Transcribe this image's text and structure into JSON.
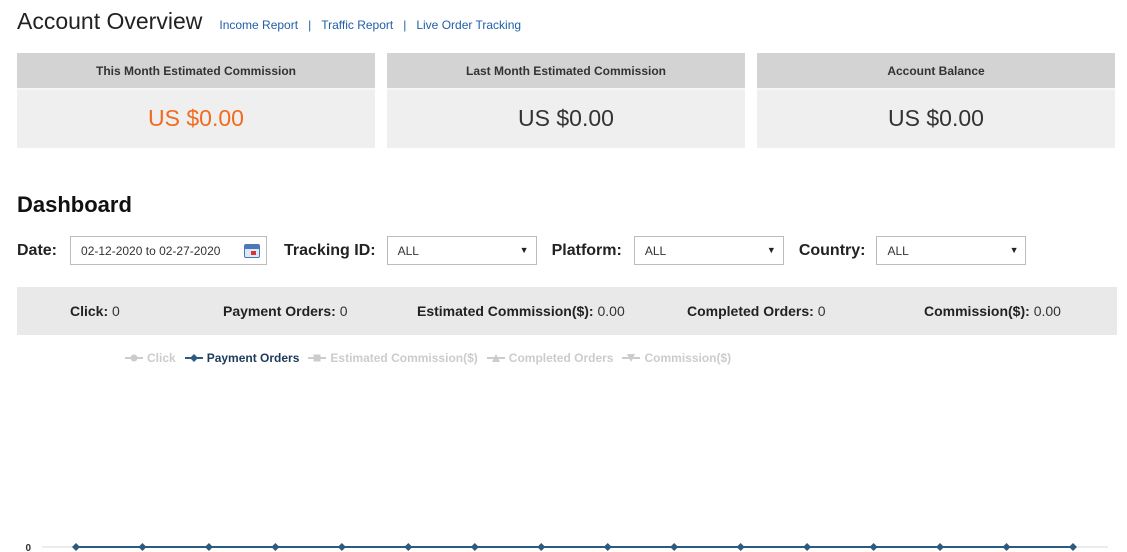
{
  "header": {
    "title": "Account Overview",
    "links": [
      "Income Report",
      "Traffic Report",
      "Live Order Tracking"
    ],
    "separator": "|"
  },
  "cards": [
    {
      "label": "This Month Estimated Commission",
      "value": "US $0.00",
      "color": "#f26b1d"
    },
    {
      "label": "Last Month Estimated Commission",
      "value": "US $0.00",
      "color": "#333333"
    },
    {
      "label": "Account Balance",
      "value": "US $0.00",
      "color": "#333333"
    }
  ],
  "dashboard": {
    "title": "Dashboard",
    "date_label": "Date:",
    "date_value": "02-12-2020 to 02-27-2020",
    "tracking_label": "Tracking ID:",
    "tracking_value": "ALL",
    "platform_label": "Platform:",
    "platform_value": "ALL",
    "country_label": "Country:",
    "country_value": "ALL"
  },
  "stats": [
    {
      "label": "Click:",
      "value": "0"
    },
    {
      "label": "Payment Orders:",
      "value": "0"
    },
    {
      "label": "Estimated Commission($):",
      "value": "0.00"
    },
    {
      "label": "Completed Orders:",
      "value": "0"
    },
    {
      "label": "Commission($):",
      "value": "0.00"
    }
  ],
  "chart_data": {
    "type": "line",
    "series": [
      {
        "name": "Click",
        "active": false
      },
      {
        "name": "Payment Orders",
        "active": true,
        "color": "#2e5b7d",
        "values": [
          0,
          0,
          0,
          0,
          0,
          0,
          0,
          0,
          0,
          0,
          0,
          0,
          0,
          0,
          0,
          0
        ]
      },
      {
        "name": "Estimated Commission($)",
        "active": false
      },
      {
        "name": "Completed Orders",
        "active": false
      },
      {
        "name": "Commission($)",
        "active": false
      }
    ],
    "y_tick_labels": [
      "0"
    ],
    "ylim": [
      0,
      0
    ]
  }
}
